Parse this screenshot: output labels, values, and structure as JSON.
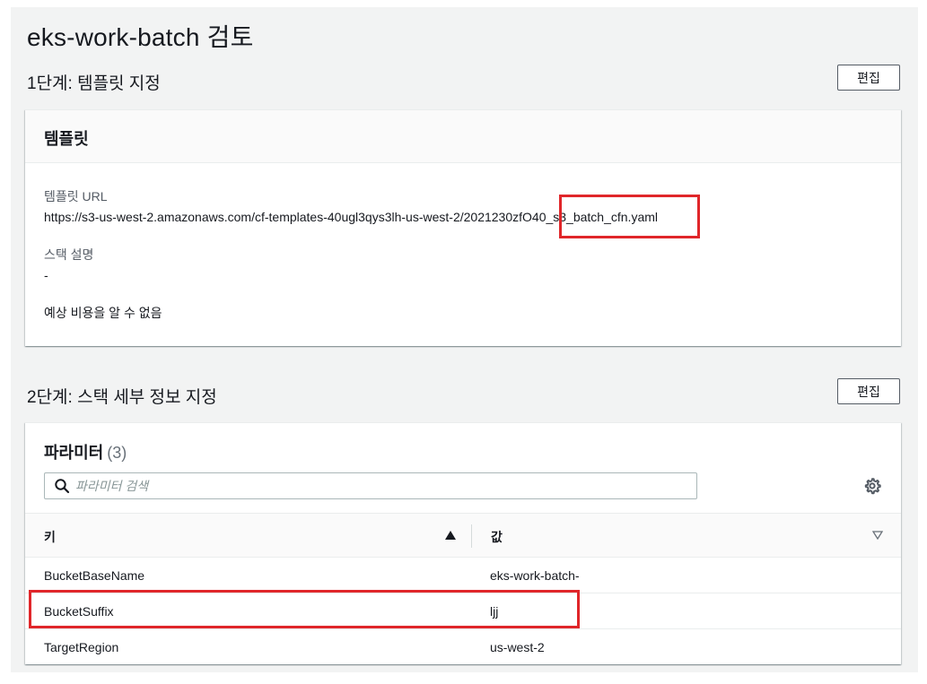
{
  "page": {
    "title": "eks-work-batch 검토"
  },
  "step1": {
    "heading": "1단계: 템플릿 지정",
    "edit_label": "편집",
    "panel_title": "템플릿",
    "template_url_label": "템플릿 URL",
    "template_url": "https://s3-us-west-2.amazonaws.com/cf-templates-40ugl3qys3lh-us-west-2/2021230zfO40_s3_batch_cfn.yaml",
    "stack_description_label": "스택 설명",
    "stack_description": "-",
    "cost_note": "예상 비용을 알 수 없음"
  },
  "step2": {
    "heading": "2단계: 스택 세부 정보 지정",
    "edit_label": "편집",
    "parameters": {
      "title": "파라미터",
      "count": "(3)",
      "search_placeholder": "파라미터 검색",
      "search_value": "",
      "columns": {
        "key": "키",
        "value": "값"
      },
      "rows": [
        {
          "key": "BucketBaseName",
          "value": "eks-work-batch-"
        },
        {
          "key": "BucketSuffix",
          "value": "ljj"
        },
        {
          "key": "TargetRegion",
          "value": "us-west-2"
        }
      ]
    }
  },
  "icons": {
    "search": "search-icon",
    "settings": "gear-icon",
    "sort_asc": "sort-ascending-icon",
    "sort_desc": "sort-descending-icon"
  },
  "colors": {
    "highlight": "#e0262a",
    "background": "#f2f3f3",
    "panel_header": "#fafafa"
  }
}
